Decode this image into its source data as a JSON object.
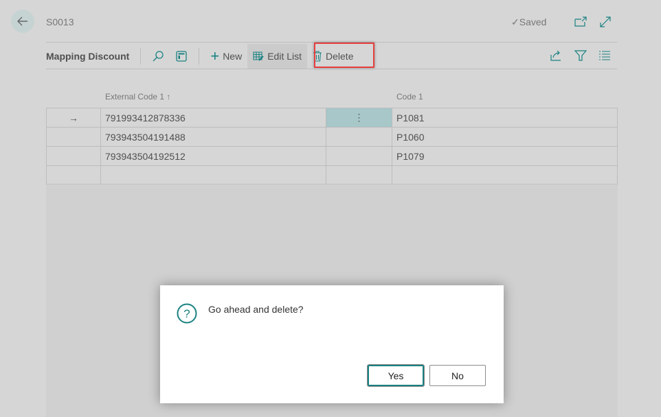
{
  "header": {
    "title": "S0013",
    "status": "Saved"
  },
  "toolbar": {
    "page_name": "Mapping Discount",
    "new_label": "New",
    "edit_list_label": "Edit List",
    "delete_label": "Delete"
  },
  "table": {
    "columns": [
      "External Code 1 ↑",
      "Code 1"
    ],
    "rows": [
      {
        "external": "791993412878336",
        "code": "P1081"
      },
      {
        "external": "793943504191488",
        "code": "P1060"
      },
      {
        "external": "793943504192512",
        "code": "P1079"
      }
    ]
  },
  "dialog": {
    "message": "Go ahead and delete?",
    "yes_label": "Yes",
    "no_label": "No"
  },
  "colors": {
    "accent": "#1a8181",
    "highlight": "#e63e3e",
    "selected_cell": "#a7c7c9"
  }
}
